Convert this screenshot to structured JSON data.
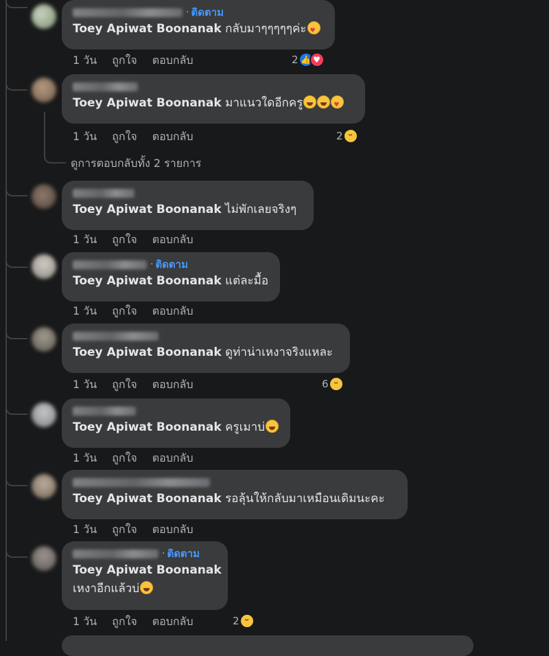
{
  "actions": {
    "time": "1 วัน",
    "like": "ถูกใจ",
    "reply": "ตอบกลับ"
  },
  "follow_label": "ติดตาม",
  "mention": "Toey Apiwat Boonanak",
  "view_replies": "ดูการตอบกลับทั้ง 2 รายการ",
  "colors": {
    "background": "#18191a",
    "bubble": "#3a3b3c",
    "follow": "#4599ff",
    "like": "#1877f2",
    "love": "#f33e58",
    "haha": "#f7c43d"
  },
  "comments": [
    {
      "text": "กลับมาๆๆๆๆๆค่ะ",
      "emoji": "smiling-face-with-hearts",
      "reactions": {
        "count": "2",
        "types": [
          "like",
          "love"
        ]
      }
    },
    {
      "text": "มาแนวใดอีกครู",
      "emoji": "rofl-grin-heart-eyes",
      "reactions": {
        "count": "2",
        "types": [
          "haha"
        ]
      }
    },
    {
      "text": "ไม่พักเลยจริงๆ"
    },
    {
      "text": "แต่ละมื้อ"
    },
    {
      "text": "ดูท่าน่าเหงาจริงแหละ",
      "reactions": {
        "count": "6",
        "types": [
          "haha"
        ]
      }
    },
    {
      "text": "ครูเมาบ่",
      "emoji": "rofl"
    },
    {
      "text": "รอลุ้นให้กลับมาเหมือนเดิมนะคะ"
    },
    {
      "text": "เหงาอีกแล้วบ่",
      "emoji": "sweat-smile",
      "reactions": {
        "count": "2",
        "types": [
          "haha"
        ]
      }
    }
  ]
}
